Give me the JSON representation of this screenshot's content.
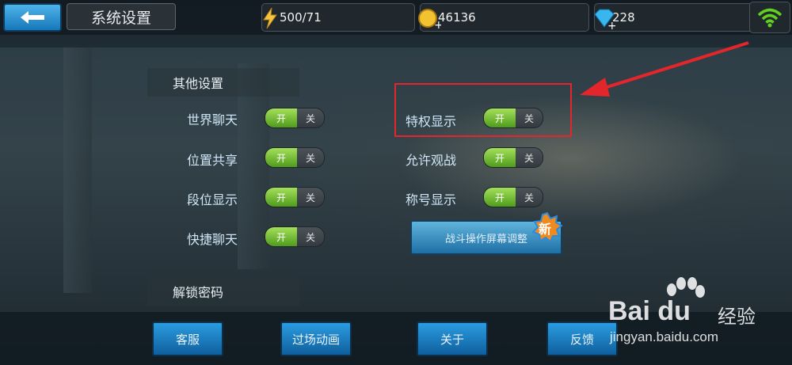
{
  "header": {
    "title": "系统设置",
    "energy": "500/71",
    "gold": "46136",
    "diamonds": "228"
  },
  "sections": {
    "other_settings": "其他设置",
    "unlock_password": "解锁密码"
  },
  "toggle_text": {
    "on": "开",
    "off": "关"
  },
  "settings_left": [
    {
      "label": "世界聊天",
      "state": "on"
    },
    {
      "label": "位置共享",
      "state": "on"
    },
    {
      "label": "段位显示",
      "state": "on"
    },
    {
      "label": "快捷聊天",
      "state": "on"
    }
  ],
  "settings_right": [
    {
      "label": "特权显示",
      "state": "on"
    },
    {
      "label": "允许观战",
      "state": "on"
    },
    {
      "label": "称号显示",
      "state": "on"
    }
  ],
  "battle_button": "战斗操作屏幕调整",
  "new_badge": "新",
  "footer": {
    "customer_service": "客服",
    "cutscene": "过场动画",
    "about": "关于",
    "feedback": "反馈"
  },
  "watermark": {
    "brand": "Bai du",
    "suffix": "经验",
    "url": "jingyan.baidu.com"
  },
  "colors": {
    "toggle_on": "#7cc43a",
    "button_blue": "#1f86c8",
    "highlight_red": "#e3262b"
  }
}
